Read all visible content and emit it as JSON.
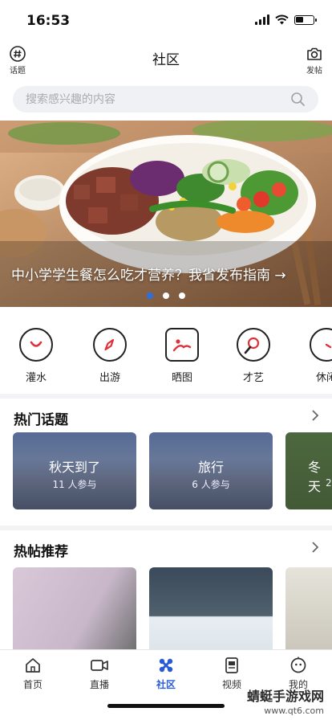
{
  "status": {
    "time": "16:53"
  },
  "header": {
    "left_label": "话题",
    "title": "社区",
    "right_label": "发帖"
  },
  "search": {
    "placeholder": "搜索感兴趣的内容"
  },
  "banner": {
    "caption": "中小学学生餐怎么吃才营养？我省发布指南 →",
    "dots": 3,
    "active_dot": 0
  },
  "categories": [
    {
      "label": "灌水",
      "icon": "chat-smile-icon"
    },
    {
      "label": "出游",
      "icon": "compass-icon"
    },
    {
      "label": "晒图",
      "icon": "picture-icon"
    },
    {
      "label": "才艺",
      "icon": "microphone-icon"
    },
    {
      "label": "休闲",
      "icon": "clock-icon"
    }
  ],
  "topics": {
    "title": "热门话题",
    "items": [
      {
        "name": "秋天到了",
        "count": "11 人参与"
      },
      {
        "name": "旅行",
        "count": "6 人参与"
      },
      {
        "name": "冬天",
        "count": "2"
      }
    ]
  },
  "hot_posts": {
    "title": "热帖推荐"
  },
  "tabbar": {
    "items": [
      {
        "label": "首页",
        "icon": "home-icon"
      },
      {
        "label": "直播",
        "icon": "video-camera-icon"
      },
      {
        "label": "社区",
        "icon": "community-icon"
      },
      {
        "label": "视频",
        "icon": "video-icon"
      },
      {
        "label": "我的",
        "icon": "profile-icon"
      }
    ],
    "active": "社区"
  },
  "watermark": {
    "line1": "蜻蜓手游戏网",
    "line2": "www.qt6.com"
  },
  "colors": {
    "accent": "#2a5bd7",
    "icon_accent": "#e0323c",
    "banner_dot_active": "#2d6fe0"
  }
}
